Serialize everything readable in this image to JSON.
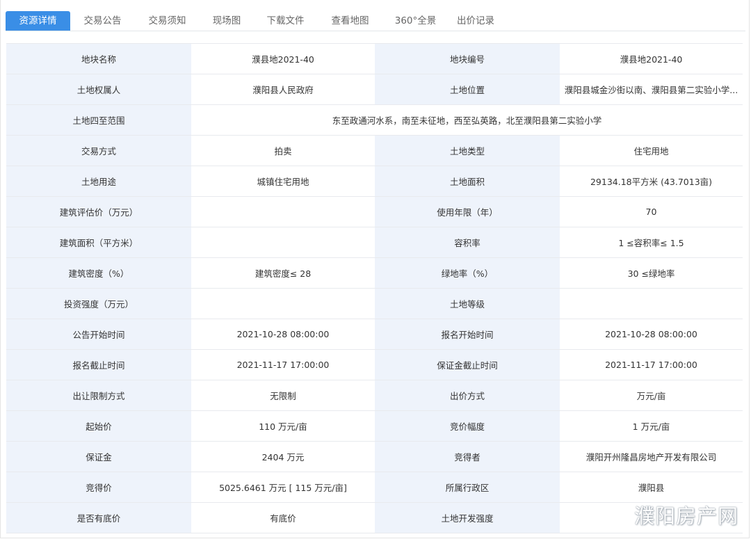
{
  "tabs": [
    {
      "label": "资源详情",
      "active": true
    },
    {
      "label": "交易公告",
      "active": false
    },
    {
      "label": "交易须知",
      "active": false
    },
    {
      "label": "现场图",
      "active": false
    },
    {
      "label": "下载文件",
      "active": false
    },
    {
      "label": "查看地图",
      "active": false
    },
    {
      "label": "360°全景",
      "active": false
    },
    {
      "label": "出价记录",
      "active": false
    }
  ],
  "rows": [
    {
      "l1": "地块名称",
      "v1": "濮县地2021-40",
      "l2": "地块编号",
      "v2": "濮县地2021-40"
    },
    {
      "l1": "土地权属人",
      "v1": "濮阳县人民政府",
      "l2": "土地位置",
      "v2": "濮阳县城金沙街以南、濮阳县第二实验小学..."
    },
    {
      "l1": "土地四至范围",
      "v1": "东至政通河水系，南至未征地，西至弘英路，北至濮阳县第二实验小学"
    },
    {
      "l1": "交易方式",
      "v1": "拍卖",
      "l2": "土地类型",
      "v2": "住宅用地"
    },
    {
      "l1": "土地用途",
      "v1": "城镇住宅用地",
      "l2": "土地面积",
      "v2": "29134.18平方米 (43.7013亩)"
    },
    {
      "l1": "建筑评估价（万元）",
      "v1": "",
      "l2": "使用年限（年）",
      "v2": "70"
    },
    {
      "l1": "建筑面积（平方米）",
      "v1": "",
      "l2": "容积率",
      "v2": "1 ≤容积率≤ 1.5"
    },
    {
      "l1": "建筑密度（%）",
      "v1": "建筑密度≤ 28",
      "l2": "绿地率（%）",
      "v2": "30 ≤绿地率"
    },
    {
      "l1": "投资强度（万元）",
      "v1": "",
      "l2": "土地等级",
      "v2": ""
    },
    {
      "l1": "公告开始时间",
      "v1": "2021-10-28 08:00:00",
      "l2": "报名开始时间",
      "v2": "2021-10-28 08:00:00"
    },
    {
      "l1": "报名截止时间",
      "v1": "2021-11-17 17:00:00",
      "l2": "保证金截止时间",
      "v2": "2021-11-17 17:00:00"
    },
    {
      "l1": "出让限制方式",
      "v1": "无限制",
      "l2": "出价方式",
      "v2": "万元/亩"
    },
    {
      "l1": "起始价",
      "v1": "110 万元/亩",
      "l2": "竞价幅度",
      "v2": "1 万元/亩"
    },
    {
      "l1": "保证金",
      "v1": "2404 万元",
      "l2": "竞得者",
      "v2": "濮阳开州隆昌房地产开发有限公司"
    },
    {
      "l1": "竞得价",
      "v1": "5025.6461 万元 [ 115 万元/亩]",
      "l2": "所属行政区",
      "v2": "濮阳县"
    },
    {
      "l1": "是否有底价",
      "v1": "有底价",
      "l2": "土地开发强度",
      "v2": ""
    }
  ],
  "watermark": "濮阳房产网",
  "colors": {
    "accent": "#3a8ee6",
    "label_bg": "#eef3fb"
  }
}
